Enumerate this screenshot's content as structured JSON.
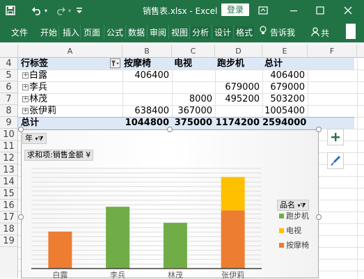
{
  "title_bar": {
    "title": "销售表.xlsx - Excel",
    "login_label": "登录",
    "icons": [
      "save-icon",
      "undo-icon",
      "undo-dropdown-icon",
      "redo-icon",
      "customize-qat-icon",
      "ribbon-display-icon",
      "minimize-icon",
      "maximize-icon",
      "close-icon"
    ]
  },
  "ribbon": {
    "tabs": [
      "文件",
      "开始",
      "插入",
      "页面",
      "公式",
      "数据",
      "审阅",
      "视图",
      "分析",
      "设计",
      "格式"
    ],
    "tell_me": "告诉我",
    "share_label": "共"
  },
  "sheet": {
    "columns": [
      "A",
      "B",
      "C",
      "D",
      "E",
      "F"
    ],
    "rows": [
      "4",
      "5",
      "6",
      "7",
      "8",
      "9",
      "10",
      "11",
      "12",
      "13",
      "14",
      "15",
      "16",
      "17",
      "18",
      "19"
    ],
    "pivot": {
      "header": {
        "row_label": "行标签",
        "cols": [
          "按摩椅",
          "电视",
          "跑步机",
          "总计"
        ]
      },
      "body": [
        {
          "name": "白露",
          "values": [
            "406400",
            "",
            "",
            "406400"
          ]
        },
        {
          "name": "李兵",
          "values": [
            "",
            "",
            "679000",
            "679000"
          ]
        },
        {
          "name": "林茂",
          "values": [
            "",
            "8000",
            "495200",
            "503200"
          ]
        },
        {
          "name": "张伊莉",
          "values": [
            "638400",
            "367000",
            "",
            "1005400"
          ]
        }
      ],
      "total": {
        "name": "总计",
        "values": [
          "1044800",
          "375000",
          "1174200",
          "2594000"
        ]
      }
    }
  },
  "chart": {
    "year_field": "年",
    "value_field": "求和项:销售金额 ¥",
    "legend_field": "品名",
    "colors": {
      "按摩椅": "#ed7d31",
      "电视": "#ffc000",
      "跑步机": "#70ad47"
    }
  },
  "chart_data": {
    "type": "bar",
    "stacked": true,
    "categories": [
      "白露",
      "李兵",
      "林茂",
      "张伊莉"
    ],
    "series": [
      {
        "name": "按摩椅",
        "values": [
          406400,
          0,
          0,
          638400
        ]
      },
      {
        "name": "电视",
        "values": [
          0,
          0,
          8000,
          367000
        ]
      },
      {
        "name": "跑步机",
        "values": [
          0,
          679000,
          495200,
          0
        ]
      }
    ],
    "legend_order": [
      "跑步机",
      "电视",
      "按摩椅"
    ],
    "ylim": [
      0,
      1100000
    ],
    "grid": true,
    "legend": "right",
    "title": ""
  }
}
